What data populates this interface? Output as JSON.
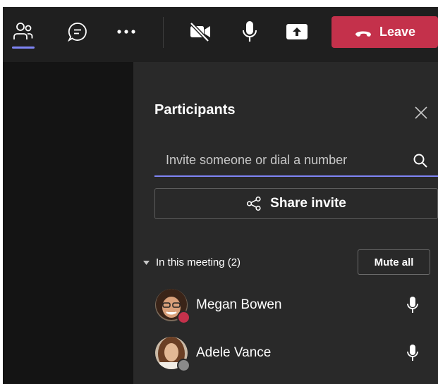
{
  "toolbar": {
    "buttons": [
      {
        "name": "people",
        "icon": "people-icon",
        "active": true
      },
      {
        "name": "chat",
        "icon": "chat-icon"
      },
      {
        "name": "more",
        "icon": "more-options-icon"
      },
      {
        "name": "camera",
        "icon": "camera-off-icon"
      },
      {
        "name": "mic",
        "icon": "microphone-icon"
      },
      {
        "name": "share",
        "icon": "share-screen-icon"
      }
    ],
    "leave_label": "Leave",
    "leave_icon": "phone-hangup-icon",
    "active_color": "#7f85f5",
    "leave_color": "#c4314b"
  },
  "panel": {
    "title": "Participants",
    "search": {
      "placeholder": "Invite someone or dial a number",
      "value": ""
    },
    "share_invite_label": "Share invite",
    "section_label": "In this meeting (2)",
    "mute_all_label": "Mute all",
    "participants": [
      {
        "name": "Megan Bowen",
        "status": "busy",
        "status_color": "#c4314b",
        "mic": "on"
      },
      {
        "name": "Adele Vance",
        "status": "offline",
        "status_color": "#8a8a8a",
        "mic": "on"
      }
    ]
  }
}
